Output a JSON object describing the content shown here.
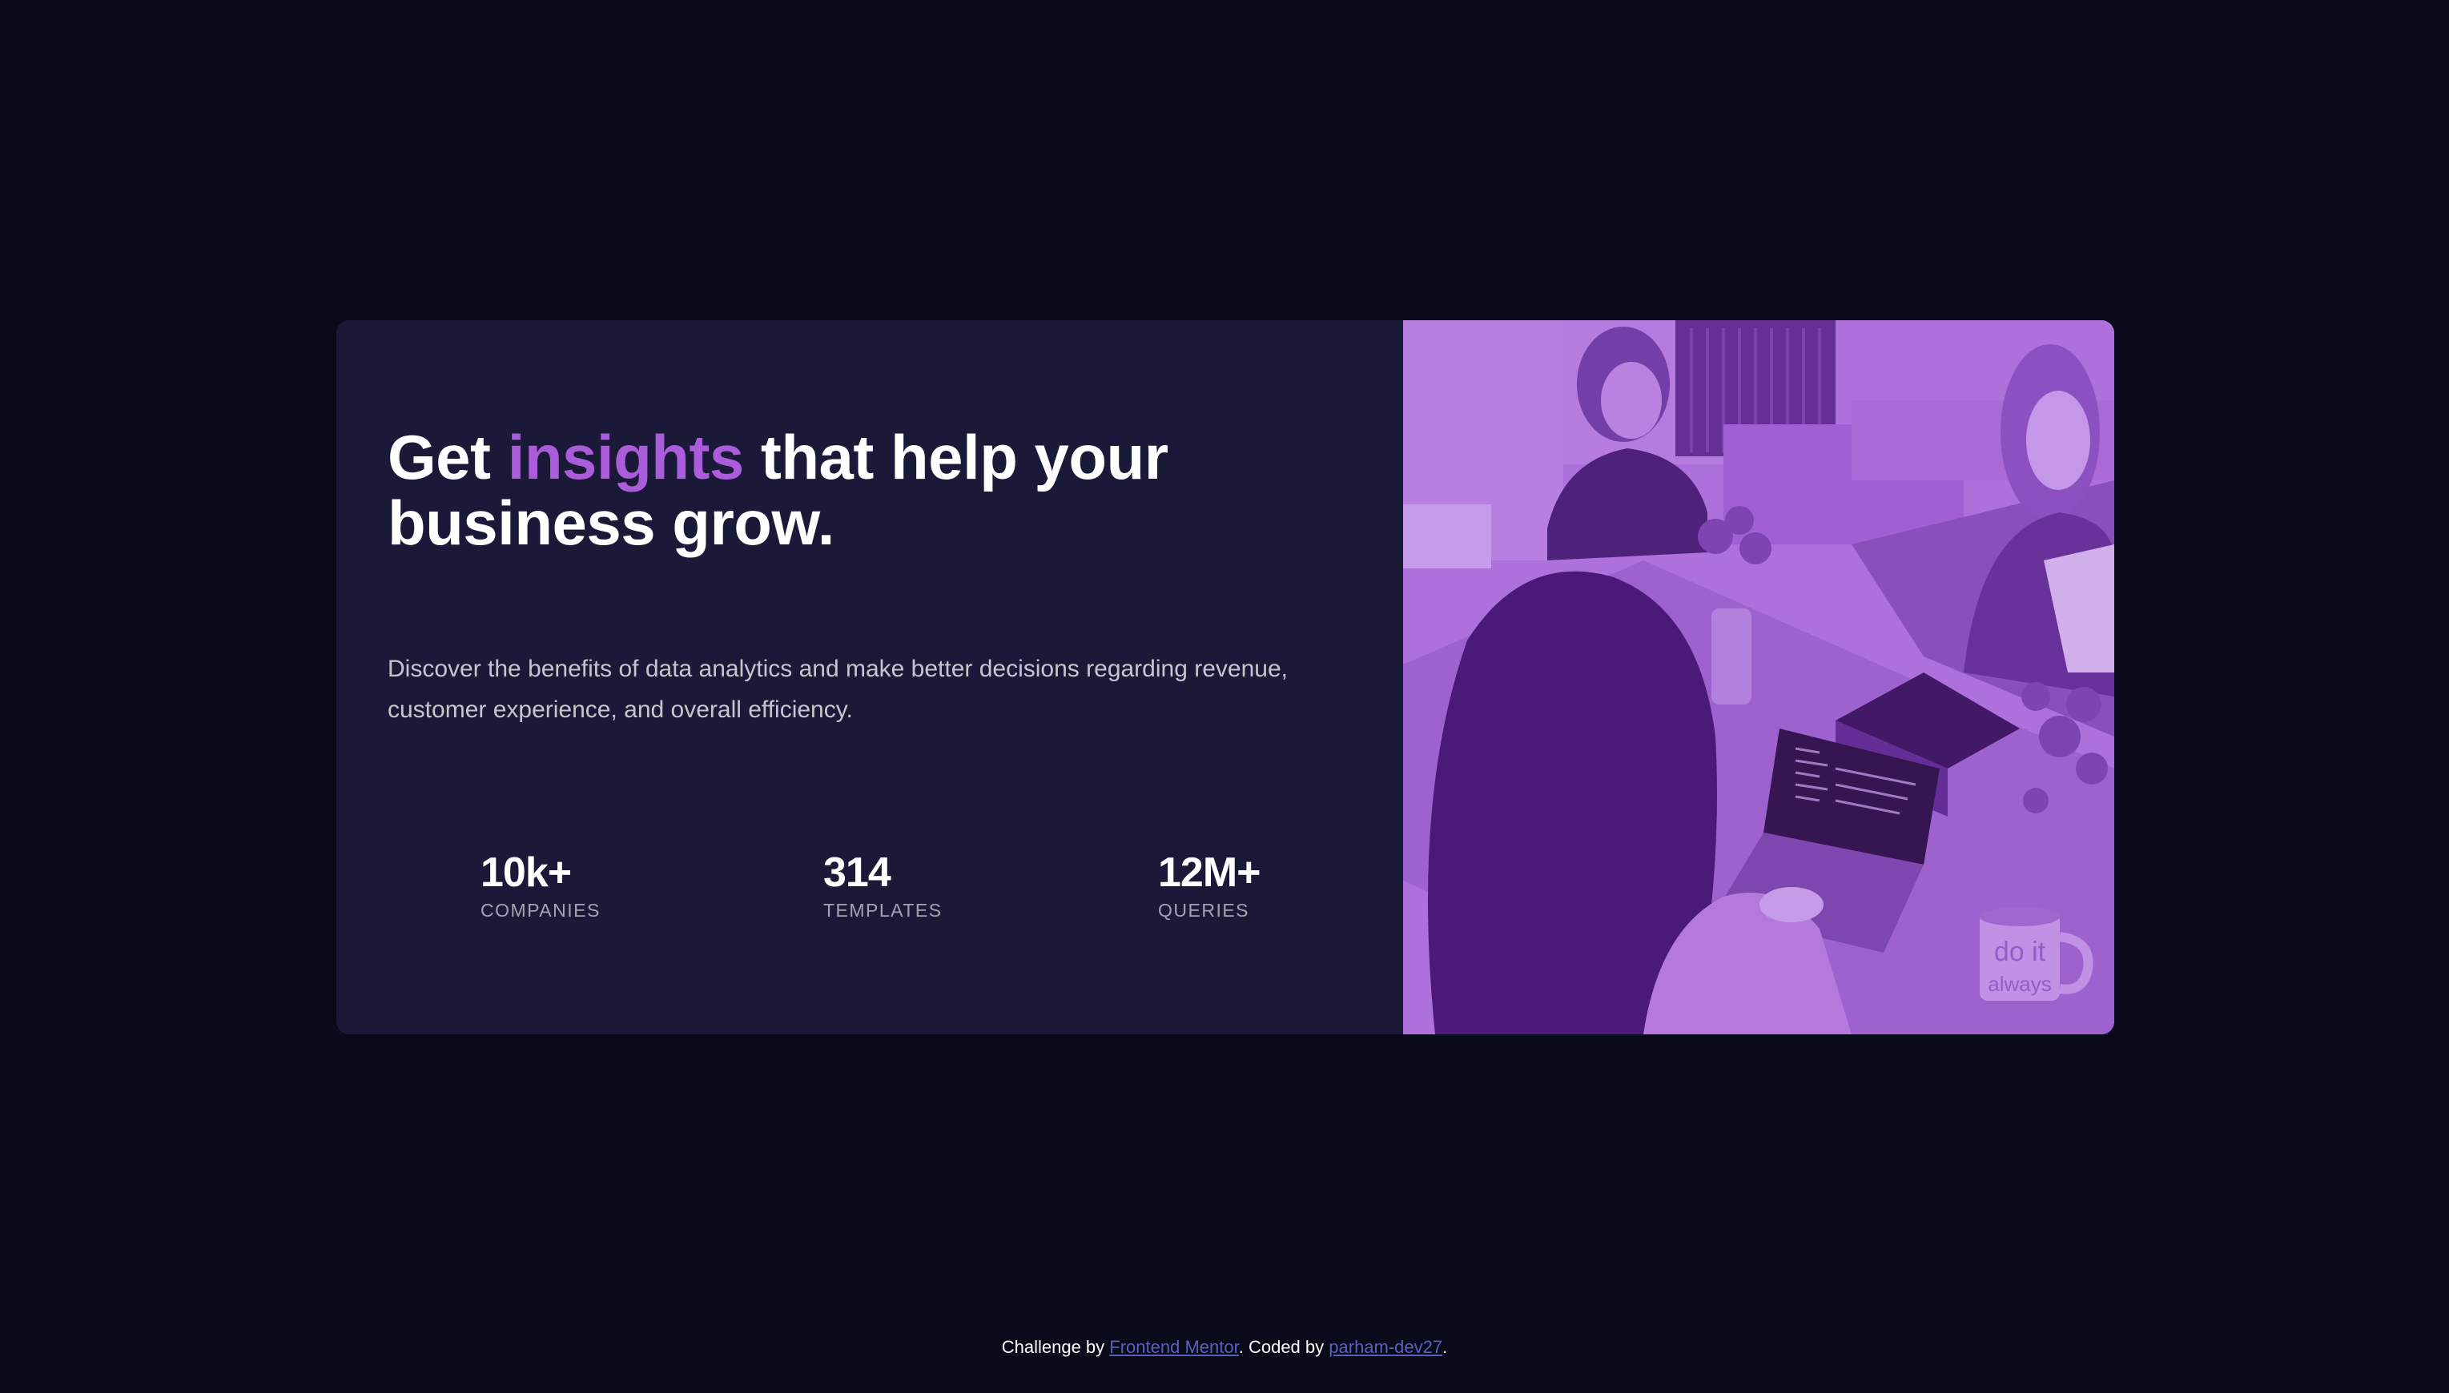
{
  "hero": {
    "headline_before": "Get",
    "headline_accent": "insights",
    "headline_after": "that help your business grow.",
    "description": "Discover the benefits of data analytics and make better decisions regarding revenue, customer experience, and overall efficiency."
  },
  "stats": [
    {
      "value": "10k+",
      "label": "COMPANIES"
    },
    {
      "value": "314",
      "label": "TEMPLATES"
    },
    {
      "value": "12M+",
      "label": "QUERIES"
    }
  ],
  "image": {
    "mug_text": "do it\nalways"
  },
  "footer": {
    "prefix": "Challenge by",
    "link1": "Frontend Mentor",
    "middle": ". Coded by",
    "link2": "parham-dev27",
    "suffix": "."
  },
  "colors": {
    "page_background": "#090b1a",
    "card_background": "#1b1938",
    "accent": "#aa5cdb",
    "link": "#5b5ebf"
  }
}
